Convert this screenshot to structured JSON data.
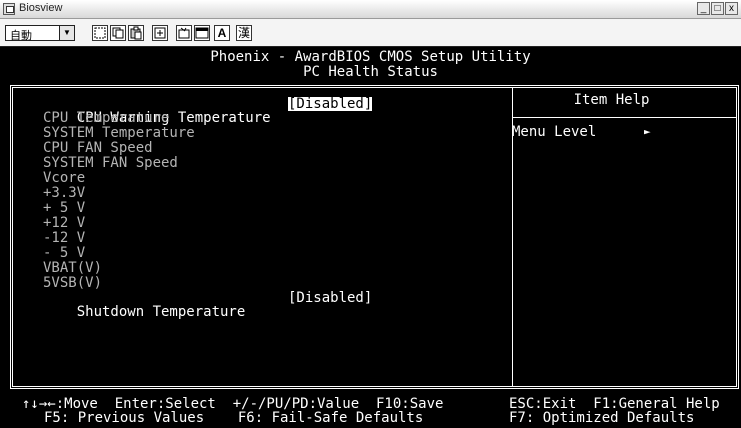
{
  "window": {
    "title": "Biosview",
    "minimize": "_",
    "maximize": "□",
    "close": "x"
  },
  "toolbar": {
    "combo_value": "自動",
    "combo_arrow": "▼",
    "font_button": "A",
    "kanji_button": "漢"
  },
  "bios": {
    "header_line1": "Phoenix - AwardBIOS CMOS Setup Utility",
    "header_line2": "PC Health Status",
    "items": [
      {
        "label": "CPU Warning Temperature",
        "value": "[Disabled]",
        "selected": true
      },
      {
        "label": "CPU Temperature"
      },
      {
        "label": "SYSTEM Temperature"
      },
      {
        "label": "CPU FAN Speed"
      },
      {
        "label": "SYSTEM FAN Speed"
      },
      {
        "label": "Vcore"
      },
      {
        "label": "+3.3V"
      },
      {
        "label": "+ 5 V"
      },
      {
        "label": "+12 V"
      },
      {
        "label": "-12 V"
      },
      {
        "label": "- 5 V"
      },
      {
        "label": "VBAT(V)"
      },
      {
        "label": "5VSB(V)"
      },
      {
        "label": "Shutdown Temperature",
        "value": "[Disabled]"
      }
    ],
    "help": {
      "title": "Item Help",
      "menu_level_label": "Menu Level",
      "menu_level_arrow": "►"
    },
    "footer": {
      "line1_left": "↑↓→←:Move  Enter:Select  +/-/PU/PD:Value  F10:Save",
      "line1_right": "ESC:Exit  F1:General Help",
      "line2_left": "F5: Previous Values    F6: Fail-Safe Defaults",
      "line2_right": "F7: Optimized Defaults"
    }
  },
  "colors": {
    "background": "#000000",
    "text": "#ffffff",
    "dim_text": "#b4b4b4",
    "highlight_bg": "#ffffff",
    "highlight_fg": "#000000"
  }
}
